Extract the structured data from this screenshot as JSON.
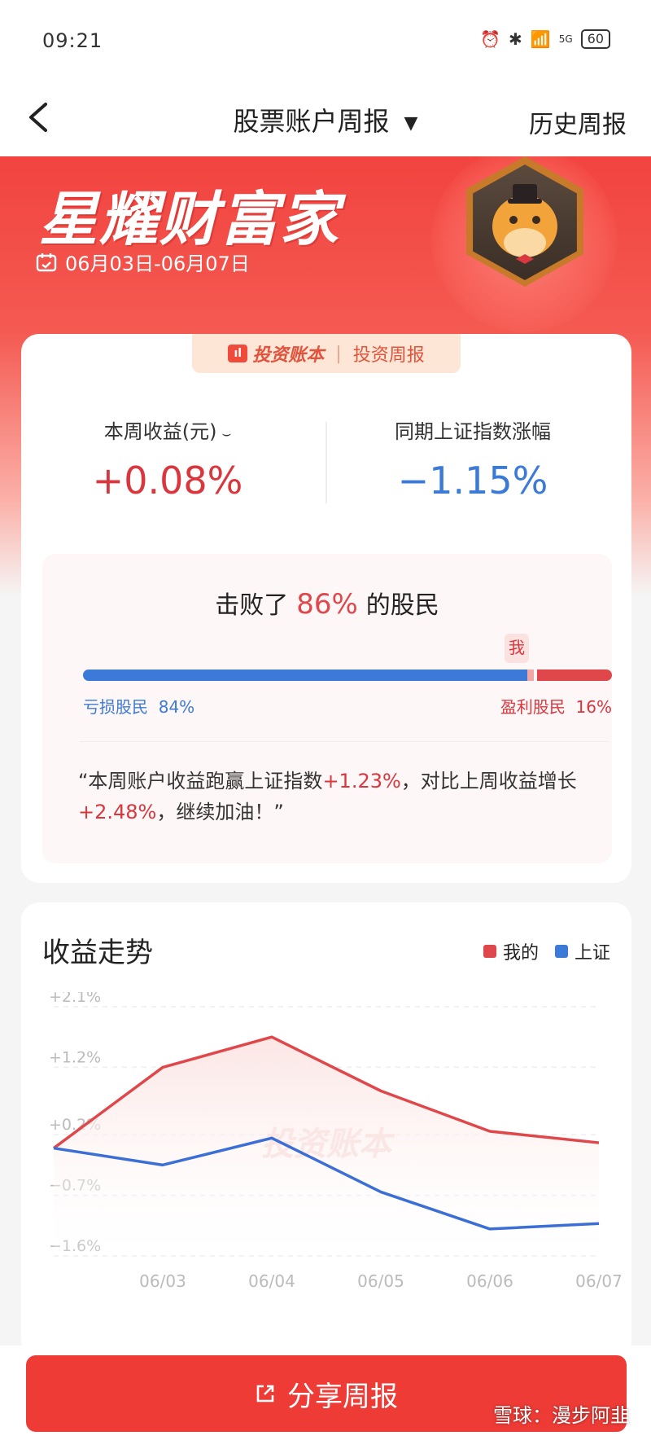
{
  "status_bar": {
    "time": "09:21",
    "signal_label": "5G",
    "battery": "60"
  },
  "nav": {
    "title": "股票账户周报",
    "history_label": "历史周报"
  },
  "hero": {
    "title": "星耀财富家",
    "date_range": "06月03日-06月07日"
  },
  "tag": {
    "brand": "投资账本",
    "label": "投资周报"
  },
  "stats": {
    "my_label": "本周收益(元)",
    "my_value": "+0.08%",
    "index_label": "同期上证指数涨幅",
    "index_value": "−1.15%"
  },
  "beat": {
    "prefix": "击败了",
    "percent": "86%",
    "suffix": "的股民",
    "me_label": "我",
    "loss_label": "亏损股民",
    "loss_pct": "84%",
    "loss_fraction": 0.84,
    "gain_label": "盈利股民",
    "gain_pct": "16%"
  },
  "quote": {
    "part1": "“本周账户收益跑赢上证指数",
    "hl1": "+1.23%",
    "part2": "，对比上周收益增长",
    "hl2": "+2.48%",
    "part3": "，继续加油！”"
  },
  "chart_data": {
    "type": "line",
    "title": "收益走势",
    "x": [
      "",
      "06/03",
      "06/04",
      "06/05",
      "06/06",
      "06/07"
    ],
    "y_ticks": [
      "+2.1%",
      "+1.2%",
      "+0.2%",
      "−0.7%",
      "−1.6%"
    ],
    "y_tick_values": [
      2.1,
      1.2,
      0.2,
      -0.7,
      -1.6
    ],
    "ylim": [
      -1.6,
      2.1
    ],
    "grid": true,
    "legend_position": "top-right",
    "series": [
      {
        "name": "我的",
        "color": "#e0474b",
        "values": [
          0.0,
          1.2,
          1.65,
          0.85,
          0.25,
          0.08
        ]
      },
      {
        "name": "上证",
        "color": "#3b6fd6",
        "values": [
          0.0,
          -0.25,
          0.15,
          -0.65,
          -1.2,
          -1.12
        ]
      }
    ],
    "watermark": "投资账本"
  },
  "share": {
    "label": "分享周报"
  },
  "watermark": "雪球：漫步阿韭"
}
